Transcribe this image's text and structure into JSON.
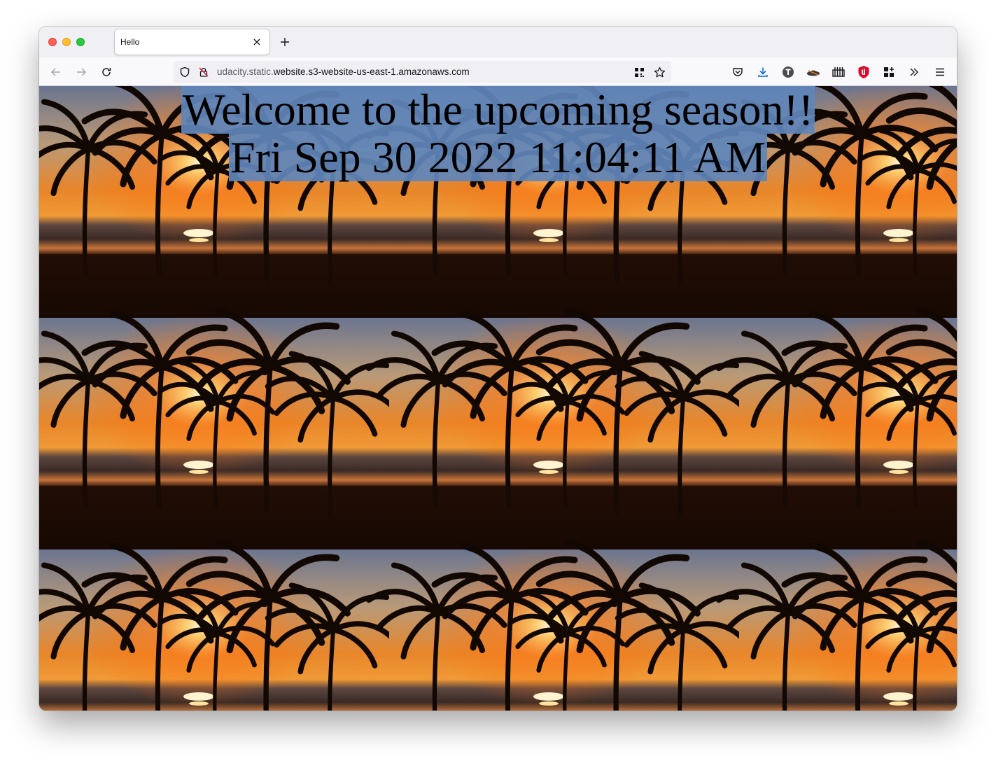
{
  "browser": {
    "tab_title": "Hello",
    "url_prefix": "udacity.static.",
    "url_host": "website.s3-website-us-east-1.amazonaws.com"
  },
  "page": {
    "heading": "Welcome to the upcoming season!!",
    "datetime": "Fri Sep 30 2022 11:04:11 AM",
    "background_image": "sunset-palm-trees-beach",
    "selection_color": "#6085b9"
  },
  "icons": {
    "back": "back-arrow-icon",
    "forward": "forward-arrow-icon",
    "reload": "reload-icon",
    "tracking": "shield-icon",
    "insecure": "insecure-lock-icon",
    "qr": "qr-code-icon",
    "bookmark": "star-icon",
    "pocket": "pocket-icon",
    "downloads": "download-icon",
    "extensions": [
      "t-extension-icon",
      "hat-extension-icon",
      "ruler-extension-icon",
      "red-shield-extension-icon",
      "grid-extension-icon"
    ],
    "overflow": "chevrons-right-icon",
    "menu": "hamburger-menu-icon"
  }
}
